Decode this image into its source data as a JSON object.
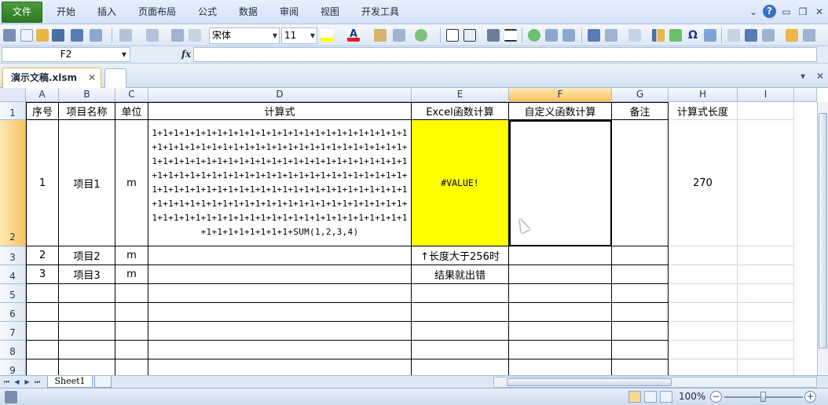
{
  "ribbon": {
    "file_tab": "文件",
    "tabs": [
      "开始",
      "插入",
      "页面布局",
      "公式",
      "数据",
      "审阅",
      "视图",
      "开发工具"
    ]
  },
  "toolbar": {
    "font_name": "宋体",
    "font_size": "11",
    "icons": [
      "save-icon",
      "new-icon",
      "open-icon",
      "print-icon",
      "undo-icon",
      "redo-icon",
      "fill-color-icon",
      "font-color-icon",
      "borders-icon",
      "camera-icon",
      "omega-icon",
      "picture-icon"
    ]
  },
  "formula_bar": {
    "name_box": "F2",
    "fx": "fx",
    "value": ""
  },
  "workbook": {
    "tab_name": "演示文稿.xlsm",
    "close": "✕"
  },
  "columns": [
    "A",
    "B",
    "C",
    "D",
    "E",
    "F",
    "G",
    "H",
    "I"
  ],
  "rows": [
    "1",
    "2",
    "3",
    "4",
    "5",
    "6",
    "7",
    "8",
    "9"
  ],
  "header_row": {
    "A": "序号",
    "B": "项目名称",
    "C": "单位",
    "D": "计算式",
    "E": "Excel函数计算",
    "F": "自定义函数计算",
    "G": "备注",
    "H": "计算式长度"
  },
  "row2": {
    "A": "1",
    "B": "项目1",
    "C": "m",
    "D": "1+1+1+1+1+1+1+1+1+1+1+1+1+1+1+1+1+1+1+1+1+1+1+1+1+1+1+1+1+1+1+1+1+1+1+1+1+1+1+1+1+1+1+1+1+1+1+1+1+1+1+1+1+1+1+1+1+1+1+1+1+1+1+1+1+1+1+1+1+1+1+1+1+1+1+1+1+1+1+1+1+1+1+1+1+1+1+1+1+1+1+1+1+1+1+1+1+1+1+1+1+1+1+1+1+1+1+1+1+1+1+1+1+1+1+1+1+1+1+1+1+1+1+1+1+1+1+1+1+1+1+1+1+1+1+1+1+1+1+1+1+1+1+1+1+1+1+1+1+1+1+1+1+1+1+1+1+1+1+1+1+1+1+1+1+1+1+1+1+1+1+1+1+SUM(1,2,3,4)",
    "E": "#VALUE!",
    "H": "270"
  },
  "row3": {
    "A": "2",
    "B": "项目2",
    "C": "m",
    "E": "↑长度大于256时"
  },
  "row4": {
    "A": "3",
    "B": "项目3",
    "C": "m",
    "E": "结果就出错"
  },
  "sheets": [
    "Sheet1"
  ],
  "status": {
    "zoom": "100%"
  },
  "colors": {
    "highlight": "#ffff00",
    "file_tab": "#2d7a23",
    "selection": "#f7c35e"
  }
}
